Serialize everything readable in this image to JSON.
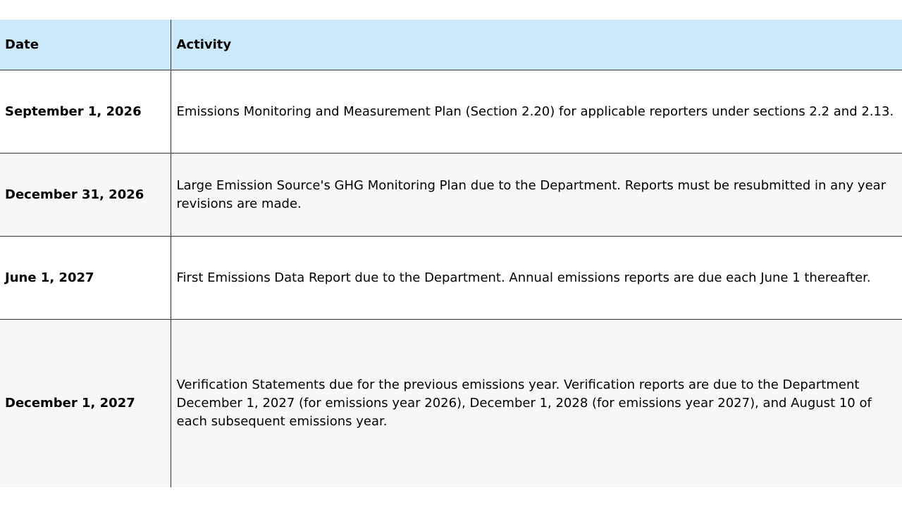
{
  "table": {
    "headers": {
      "date": "Date",
      "activity": "Activity"
    },
    "rows": [
      {
        "date": "September 1, 2026",
        "activity": "Emissions Monitoring and Measurement Plan (Section 2.20) for applicable reporters under sections 2.2 and 2.13."
      },
      {
        "date": "December 31, 2026",
        "activity": "Large Emission Source's GHG Monitoring Plan due to the Department. Reports must be resubmitted in any year revisions are made."
      },
      {
        "date": "June 1, 2027",
        "activity": "First Emissions Data Report due to the Department. Annual emissions reports are due each June 1 thereafter."
      },
      {
        "date": "December 1, 2027",
        "activity": "Verification Statements due for the previous emissions year. Verification reports are due to the Department December 1, 2027 (for emissions year 2026), December 1, 2028 (for emissions year 2027), and August 10 of each subsequent emissions year."
      }
    ]
  },
  "colors": {
    "header_background": "#cce9fc",
    "alt_row_background": "#f8f8f6",
    "border": "#333333"
  }
}
